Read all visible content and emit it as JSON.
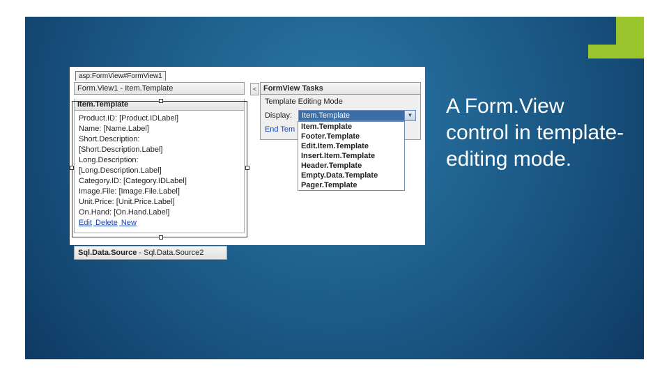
{
  "caption": "A Form.View control in template-editing mode.",
  "designer": {
    "controlTag": "asp:FormView#FormView1",
    "title": "Form.View1 - Item.Template",
    "sectionHeader": "Item.Template",
    "fields": [
      "Product.ID: [Product.IDLabel]",
      "Name: [Name.Label]",
      "Short.Description:",
      "[Short.Description.Label]",
      "Long.Description:",
      "[Long.Description.Label]",
      "Category.ID: [Category.IDLabel]",
      "Image.File: [Image.File.Label]",
      "Unit.Price: [Unit.Price.Label]",
      "On.Hand: [On.Hand.Label]"
    ],
    "links": {
      "edit": "Edit",
      "delete": "Delete",
      "new": "New"
    },
    "dataSource": {
      "label": "Sql.Data.Source",
      "value": "Sql.Data.Source2"
    }
  },
  "tasks": {
    "header": "FormView Tasks",
    "mode": "Template Editing Mode",
    "displayLabel": "Display:",
    "selected": "Item.Template",
    "endLabel": "End Tem",
    "options": [
      "Item.Template",
      "Footer.Template",
      "Edit.Item.Template",
      "Insert.Item.Template",
      "Header.Template",
      "Empty.Data.Template",
      "Pager.Template"
    ]
  }
}
